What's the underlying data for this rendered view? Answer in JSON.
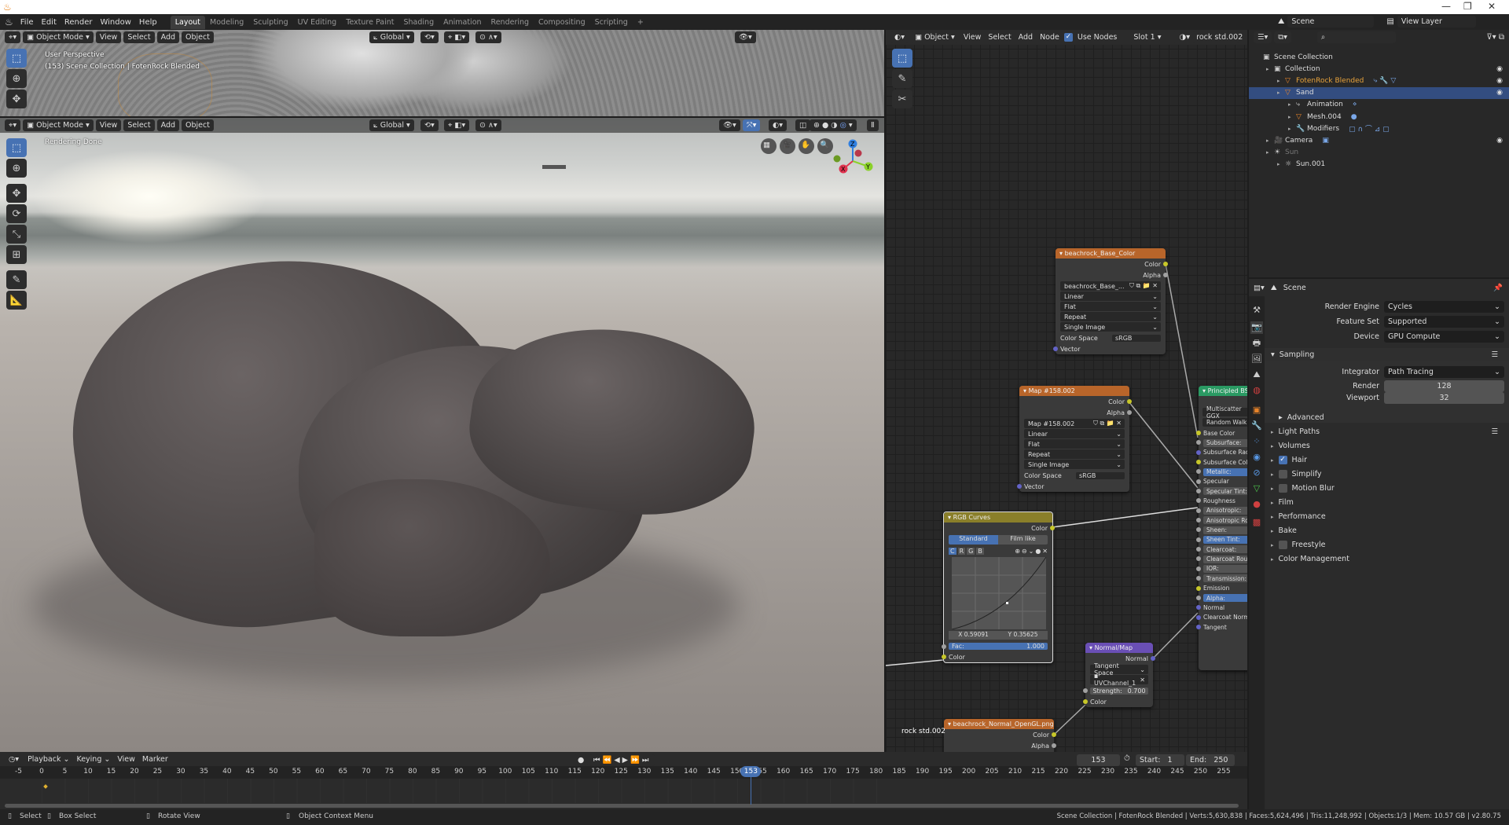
{
  "menu": [
    "File",
    "Edit",
    "Render",
    "Window",
    "Help"
  ],
  "workspaces": [
    "Layout",
    "Modeling",
    "Sculpting",
    "UV Editing",
    "Texture Paint",
    "Shading",
    "Animation",
    "Rendering",
    "Compositing",
    "Scripting",
    "+"
  ],
  "active_workspace": "Layout",
  "scene_name": "Scene",
  "view_layer": "View Layer",
  "viewport_top": {
    "mode": "Object Mode",
    "menus": [
      "View",
      "Select",
      "Add",
      "Object"
    ],
    "orientation": "Global",
    "overlay_title": "User Perspective",
    "overlay_sub": "(153) Scene Collection | FotenRock Blended"
  },
  "viewport_bottom": {
    "mode": "Object Mode",
    "menus": [
      "View",
      "Select",
      "Add",
      "Object"
    ],
    "orientation": "Global",
    "overlay_title": "Rendering Done",
    "gizmo": {
      "x": "X",
      "y": "Y",
      "z": "Z"
    }
  },
  "node_editor": {
    "header": {
      "object": "Object",
      "menus": [
        "View",
        "Select",
        "Add",
        "Node"
      ],
      "use_nodes": "Use Nodes",
      "slot": "Slot 1",
      "material": "rock std.002"
    },
    "material_label": "rock std.002",
    "base_color_node": {
      "title": "beachrock_Base_Color",
      "outputs": [
        "Color",
        "Alpha"
      ],
      "image": "beachrock_Base_...",
      "interp": "Linear",
      "proj": "Flat",
      "ext": "Repeat",
      "source": "Single Image",
      "cs_label": "Color Space",
      "cs": "sRGB",
      "input": "Vector"
    },
    "map_node": {
      "title": "Map #158.002",
      "outputs": [
        "Color",
        "Alpha"
      ],
      "image": "Map #158.002",
      "interp": "Linear",
      "proj": "Flat",
      "ext": "Repeat",
      "source": "Single Image",
      "cs_label": "Color Space",
      "cs": "sRGB",
      "input": "Vector"
    },
    "rgb_curves": {
      "title": "RGB Curves",
      "output": "Color",
      "tabs": [
        "Standard",
        "Film like"
      ],
      "channels": [
        "C",
        "R",
        "G",
        "B"
      ],
      "x": "X 0.59091",
      "y": "Y 0.35625",
      "fac_label": "Fac:",
      "fac": "1.000",
      "input": "Color"
    },
    "normal_map": {
      "title": "Normal/Map",
      "output": "Normal",
      "space": "Tangent Space",
      "uv": "UVChannel_1",
      "strength_label": "Strength:",
      "strength": "0.700",
      "input": "Color"
    },
    "normal_tex": {
      "title": "beachrock_Normal_OpenGL.png",
      "outputs": [
        "Color",
        "Alpha"
      ]
    },
    "bsdf": {
      "title": "Principled BSDF",
      "dists": [
        "Multiscatter GGX",
        "Random Walk"
      ],
      "inputs": [
        {
          "label": "Base Color",
          "sock": "y",
          "field": false
        },
        {
          "label": "Subsurface:",
          "sock": "g",
          "field": true
        },
        {
          "label": "Subsurface Radius",
          "sock": "p",
          "field": false
        },
        {
          "label": "Subsurface Color",
          "sock": "y",
          "field": false
        },
        {
          "label": "Metallic:",
          "sock": "g",
          "field": true,
          "hl": true
        },
        {
          "label": "Specular",
          "sock": "g",
          "field": false
        },
        {
          "label": "Specular Tint:",
          "sock": "g",
          "field": true
        },
        {
          "label": "Roughness",
          "sock": "g",
          "field": false
        },
        {
          "label": "Anisotropic:",
          "sock": "g",
          "field": true
        },
        {
          "label": "Anisotropic Rotation",
          "sock": "g",
          "field": true
        },
        {
          "label": "Sheen:",
          "sock": "g",
          "field": true
        },
        {
          "label": "Sheen Tint:",
          "sock": "g",
          "field": true,
          "hl": true
        },
        {
          "label": "Clearcoat:",
          "sock": "g",
          "field": true
        },
        {
          "label": "Clearcoat Roughness",
          "sock": "g",
          "field": true
        },
        {
          "label": "IOR:",
          "sock": "g",
          "field": true
        },
        {
          "label": "Transmission:",
          "sock": "g",
          "field": true
        },
        {
          "label": "Emission",
          "sock": "y",
          "field": false
        },
        {
          "label": "Alpha:",
          "sock": "g",
          "field": true,
          "hl": true
        },
        {
          "label": "Normal",
          "sock": "p",
          "field": false
        },
        {
          "label": "Clearcoat Normal",
          "sock": "p",
          "field": false
        },
        {
          "label": "Tangent",
          "sock": "p",
          "field": false
        }
      ]
    }
  },
  "outliner": {
    "items": [
      {
        "label": "Scene Collection",
        "indent": 0,
        "icon": "▣"
      },
      {
        "label": "Collection",
        "indent": 1,
        "icon": "▣",
        "eye": true
      },
      {
        "label": "FotenRock Blended",
        "indent": 2,
        "icon": "▽",
        "eye": true,
        "color": "#e8a33c",
        "extras": "⤷ 🔧 ▽"
      },
      {
        "label": "Sand",
        "indent": 2,
        "icon": "▽",
        "eye": true,
        "selected": true
      },
      {
        "label": "Animation",
        "indent": 3,
        "icon": "⤷",
        "extras": "⋄"
      },
      {
        "label": "Mesh.004",
        "indent": 3,
        "icon": "▽",
        "extras": "●"
      },
      {
        "label": "Modifiers",
        "indent": 3,
        "icon": "🔧",
        "extras": "▢ ∩ ⌒ ⊿ ▢"
      },
      {
        "label": "Camera",
        "indent": 1,
        "icon": "🎥",
        "eye": true,
        "extras": "▣"
      },
      {
        "label": "Sun",
        "indent": 1,
        "icon": "☀",
        "dim": true
      },
      {
        "label": "Sun.001",
        "indent": 2,
        "icon": "☼"
      }
    ]
  },
  "properties": {
    "context": "Scene",
    "render_engine_label": "Render Engine",
    "render_engine": "Cycles",
    "feature_set_label": "Feature Set",
    "feature_set": "Supported",
    "device_label": "Device",
    "device": "GPU Compute",
    "sampling": "Sampling",
    "integrator_label": "Integrator",
    "integrator": "Path Tracing",
    "render_label": "Render",
    "render_samples": "128",
    "viewport_label": "Viewport",
    "viewport_samples": "32",
    "advanced": "Advanced",
    "sections": [
      {
        "label": "Light Paths"
      },
      {
        "label": "Volumes"
      },
      {
        "label": "Hair",
        "check": true
      },
      {
        "label": "Simplify",
        "check": false
      },
      {
        "label": "Motion Blur",
        "check": false
      },
      {
        "label": "Film"
      },
      {
        "label": "Performance"
      },
      {
        "label": "Bake"
      },
      {
        "label": "Freestyle",
        "check": false
      },
      {
        "label": "Color Management"
      }
    ]
  },
  "timeline": {
    "menus": [
      "Playback",
      "Keying",
      "View",
      "Marker"
    ],
    "current_frame": "153",
    "start_label": "Start:",
    "start": "1",
    "end_label": "End:",
    "end": "250",
    "ticks": [
      -5,
      0,
      5,
      10,
      15,
      20,
      25,
      30,
      35,
      40,
      45,
      50,
      55,
      60,
      65,
      70,
      75,
      80,
      85,
      90,
      95,
      100,
      105,
      110,
      115,
      120,
      125,
      130,
      135,
      140,
      145,
      150,
      155,
      160,
      165,
      170,
      175,
      180,
      185,
      190,
      195,
      200,
      205,
      210,
      215,
      220,
      225,
      230,
      235,
      240,
      245,
      250,
      255
    ]
  },
  "status": {
    "hints": [
      "Select",
      "Box Select",
      "Rotate View",
      "Object Context Menu"
    ],
    "info": "Scene Collection | FotenRock Blended | Verts:5,630,838 | Faces:5,624,496 | Tris:11,248,992 | Objects:1/3 | Mem: 10.57 GB | v2.80.75"
  }
}
